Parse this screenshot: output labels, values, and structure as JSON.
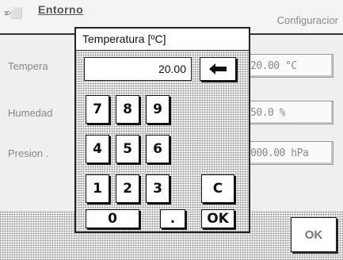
{
  "header": {
    "title": "Entorno",
    "right_text": "Configuracior"
  },
  "rows": [
    {
      "label": "Tempera",
      "value": "20.00 °C"
    },
    {
      "label": "Humedad",
      "value": "50.0 %"
    },
    {
      "label": "Presion .",
      "value": "000.00 hPa"
    }
  ],
  "footer": {
    "ok_label": "OK"
  },
  "dialog": {
    "title": "Temperatura [ºC]",
    "value": "20.00",
    "keys": {
      "k7": "7",
      "k8": "8",
      "k9": "9",
      "k4": "4",
      "k5": "5",
      "k6": "6",
      "k1": "1",
      "k2": "2",
      "k3": "3",
      "k0": "0",
      "dot": ".",
      "clear": "C",
      "ok": "OK"
    }
  }
}
